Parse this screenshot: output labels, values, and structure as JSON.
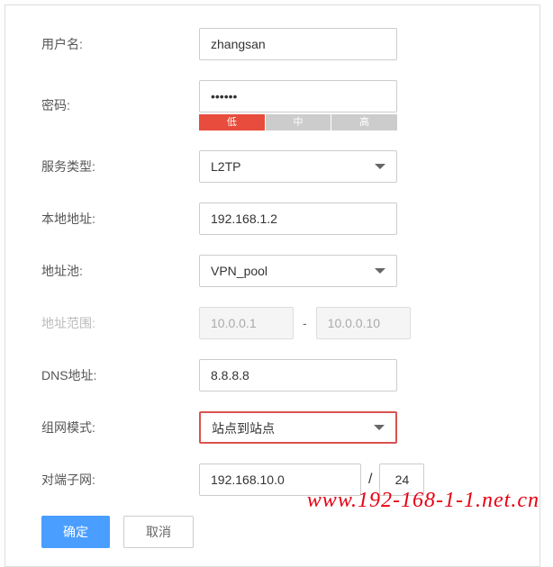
{
  "form": {
    "username": {
      "label": "用户名:",
      "value": "zhangsan"
    },
    "password": {
      "label": "密码:",
      "value": "••••••"
    },
    "strength": {
      "low": "低",
      "mid": "中",
      "high": "高"
    },
    "service_type": {
      "label": "服务类型:",
      "value": "L2TP"
    },
    "local_address": {
      "label": "本地地址:",
      "value": "192.168.1.2"
    },
    "address_pool": {
      "label": "地址池:",
      "value": "VPN_pool"
    },
    "address_range": {
      "label": "地址范围:",
      "start": "10.0.0.1",
      "end": "10.0.0.10",
      "sep": "-"
    },
    "dns": {
      "label": "DNS地址:",
      "value": "8.8.8.8"
    },
    "network_mode": {
      "label": "组网模式:",
      "value": "站点到站点"
    },
    "peer_subnet": {
      "label": "对端子网:",
      "value": "192.168.10.0",
      "mask": "24",
      "slash": "/"
    }
  },
  "buttons": {
    "ok": "确定",
    "cancel": "取消"
  },
  "watermark": "www.192-168-1-1.net.cn"
}
